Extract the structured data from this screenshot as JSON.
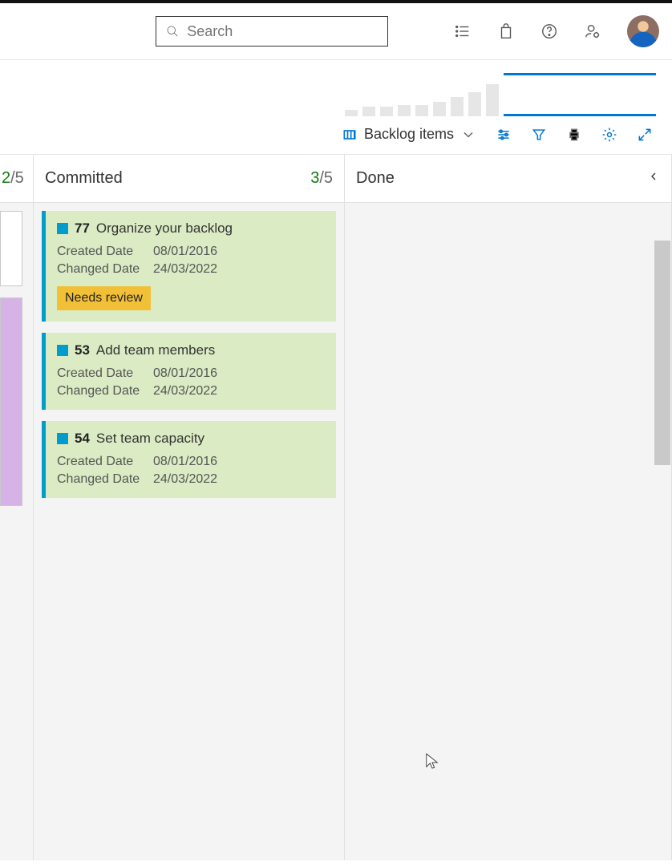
{
  "search": {
    "placeholder": "Search"
  },
  "toolbar": {
    "view_label": "Backlog items"
  },
  "columns": {
    "partial": {
      "count_num": "2",
      "count_den": "/5"
    },
    "committed": {
      "title": "Committed",
      "count_num": "3",
      "count_den": "/5"
    },
    "done": {
      "title": "Done"
    }
  },
  "cards": [
    {
      "id": "77",
      "title": "Organize your backlog",
      "created_label": "Created Date",
      "created_value": "08/01/2016",
      "changed_label": "Changed Date",
      "changed_value": "24/03/2022",
      "tag": "Needs review"
    },
    {
      "id": "53",
      "title": "Add team members",
      "created_label": "Created Date",
      "created_value": "08/01/2016",
      "changed_label": "Changed Date",
      "changed_value": "24/03/2022"
    },
    {
      "id": "54",
      "title": "Set team capacity",
      "created_label": "Created Date",
      "created_value": "08/01/2016",
      "changed_label": "Changed Date",
      "changed_value": "24/03/2022"
    }
  ],
  "chart_data": {
    "type": "bar",
    "bars": [
      8,
      12,
      12,
      14,
      14,
      18,
      24,
      30,
      40
    ],
    "title": "",
    "xlabel": "",
    "ylabel": ""
  }
}
